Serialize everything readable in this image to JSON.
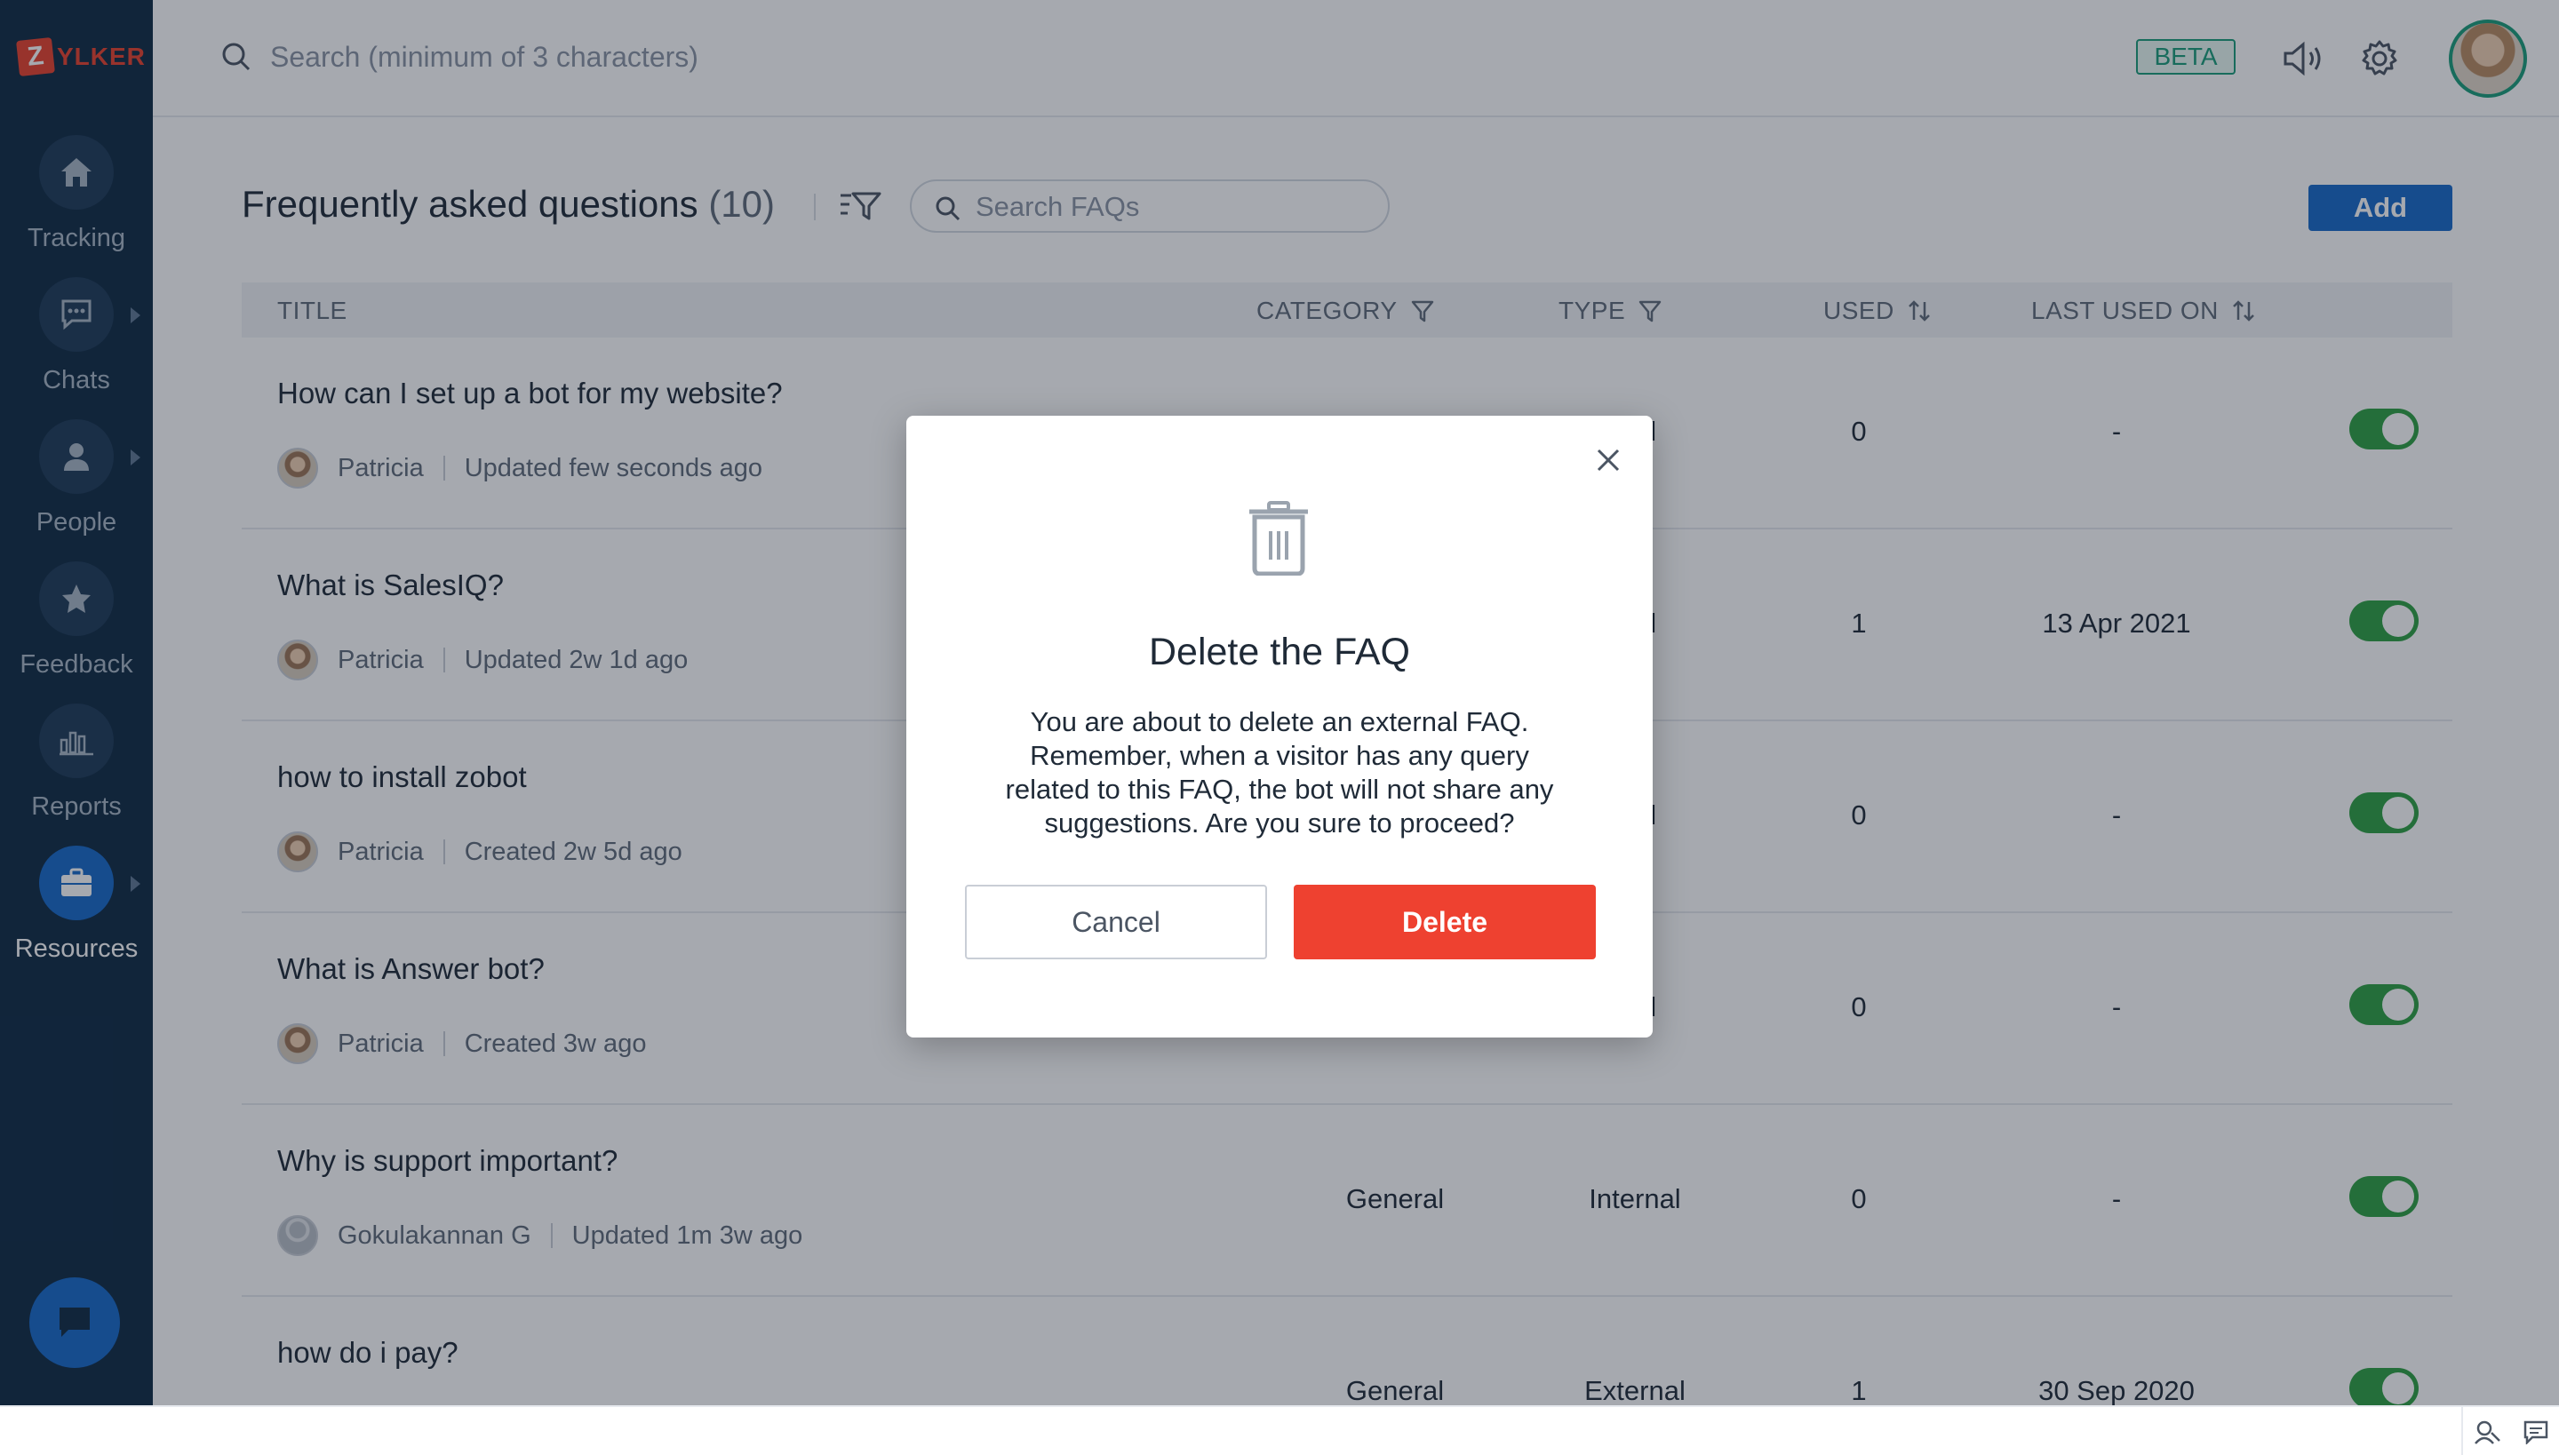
{
  "brand": {
    "logo_letter": "Z",
    "logo_text": "YLKER"
  },
  "sidebar": {
    "items": [
      {
        "label": "Tracking",
        "icon": "home-icon"
      },
      {
        "label": "Chats",
        "icon": "chat-icon"
      },
      {
        "label": "People",
        "icon": "person-icon"
      },
      {
        "label": "Feedback",
        "icon": "star-icon"
      },
      {
        "label": "Reports",
        "icon": "bar-chart-icon"
      },
      {
        "label": "Resources",
        "icon": "briefcase-icon",
        "active": true
      }
    ]
  },
  "topbar": {
    "search_placeholder": "Search (minimum of 3 characters)",
    "beta_label": "BETA"
  },
  "page": {
    "title": "Frequently asked questions",
    "count": "(10)",
    "search_placeholder": "Search FAQs",
    "add_label": "Add"
  },
  "table": {
    "headers": {
      "title": "TITLE",
      "category": "CATEGORY",
      "type": "TYPE",
      "used": "USED",
      "last_used_on": "LAST USED ON"
    },
    "rows": [
      {
        "title": "How can I set up a bot for my website?",
        "author": "Patricia",
        "status": "Updated few seconds ago",
        "category": "",
        "type": "al",
        "used": "0",
        "last_used": "-",
        "enabled": true
      },
      {
        "title": "What is SalesIQ?",
        "author": "Patricia",
        "status": "Updated 2w 1d ago",
        "category": "",
        "type": "al",
        "used": "1",
        "last_used": "13 Apr 2021",
        "enabled": true
      },
      {
        "title": "how to install zobot",
        "author": "Patricia",
        "status": "Created 2w 5d ago",
        "category": "",
        "type": "al",
        "used": "0",
        "last_used": "-",
        "enabled": true
      },
      {
        "title": "What is Answer bot?",
        "author": "Patricia",
        "status": "Created 3w ago",
        "category": "",
        "type": "al",
        "used": "0",
        "last_used": "-",
        "enabled": true
      },
      {
        "title": "Why is support important?",
        "author": "Gokulakannan G",
        "status": "Updated 1m 3w ago",
        "category": "General",
        "type": "Internal",
        "used": "0",
        "last_used": "-",
        "enabled": true
      },
      {
        "title": "how do i pay?",
        "author": "",
        "status": "",
        "category": "General",
        "type": "External",
        "used": "1",
        "last_used": "30 Sep 2020",
        "enabled": true
      }
    ]
  },
  "modal": {
    "title": "Delete the FAQ",
    "message": "You are about to delete an external FAQ. Remember, when a visitor has any query related to this FAQ, the bot will not share any suggestions. Are you sure to proceed?",
    "cancel_label": "Cancel",
    "delete_label": "Delete"
  },
  "colors": {
    "sidebar_bg": "#0f2a43",
    "accent_blue": "#1769c8",
    "delete_red": "#ee4130",
    "toggle_green": "#2ea043",
    "beta_green": "#1a9d7a"
  }
}
